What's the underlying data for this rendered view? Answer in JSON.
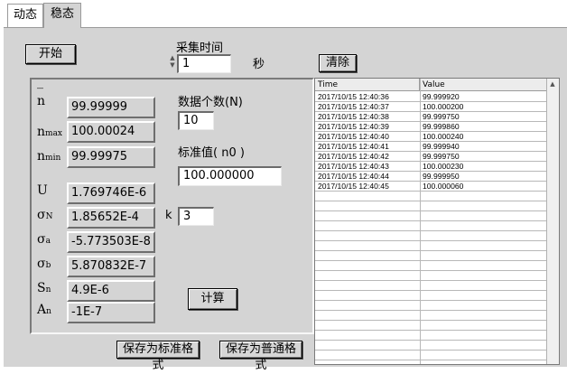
{
  "tabs": [
    {
      "label": "动态"
    },
    {
      "label": "稳态"
    }
  ],
  "controls": {
    "start_label": "开始",
    "sample_time_label": "采集时间",
    "sample_time_value": "1",
    "sample_time_unit": "秒",
    "clear_label": "清除",
    "count_label": "数据个数(N)",
    "count_value": "10",
    "std_label": "标准值( n0 )",
    "std_value": "100.000000",
    "k_label": "k",
    "k_value": "3",
    "calc_label": "计算",
    "save_std_label": "保存为标准格式",
    "save_plain_label": "保存为普通格式"
  },
  "stats": {
    "nbar": {
      "symbol": "n",
      "value": "99.99999"
    },
    "nmax": {
      "symbol": "n",
      "sub": "max",
      "value": "100.00024"
    },
    "nmin": {
      "symbol": "n",
      "sub": "min",
      "value": "99.99975"
    },
    "U": {
      "symbol": "U",
      "value": "1.769746E-6"
    },
    "sigmaN": {
      "symbol": "σ",
      "sub": "N",
      "value": "1.85652E-4"
    },
    "sigmaA": {
      "symbol": "σ",
      "sub": "a",
      "value": "-5.773503E-8"
    },
    "sigmaB": {
      "symbol": "σ",
      "sub": "b",
      "value": "5.870832E-7"
    },
    "Sn": {
      "symbol": "S",
      "sub": "n",
      "value": "4.9E-6"
    },
    "An": {
      "symbol": "A",
      "sub": "n",
      "value": "-1E-7"
    }
  },
  "table": {
    "headers": [
      "Time",
      "Value"
    ],
    "rows": [
      [
        "2017/10/15 12:40:36",
        "99.999920"
      ],
      [
        "2017/10/15 12:40:37",
        "100.000200"
      ],
      [
        "2017/10/15 12:40:38",
        "99.999750"
      ],
      [
        "2017/10/15 12:40:39",
        "99.999860"
      ],
      [
        "2017/10/15 12:40:40",
        "100.000240"
      ],
      [
        "2017/10/15 12:40:41",
        "99.999940"
      ],
      [
        "2017/10/15 12:40:42",
        "99.999750"
      ],
      [
        "2017/10/15 12:40:43",
        "100.000230"
      ],
      [
        "2017/10/15 12:40:44",
        "99.999950"
      ],
      [
        "2017/10/15 12:40:45",
        "100.000060"
      ]
    ]
  }
}
